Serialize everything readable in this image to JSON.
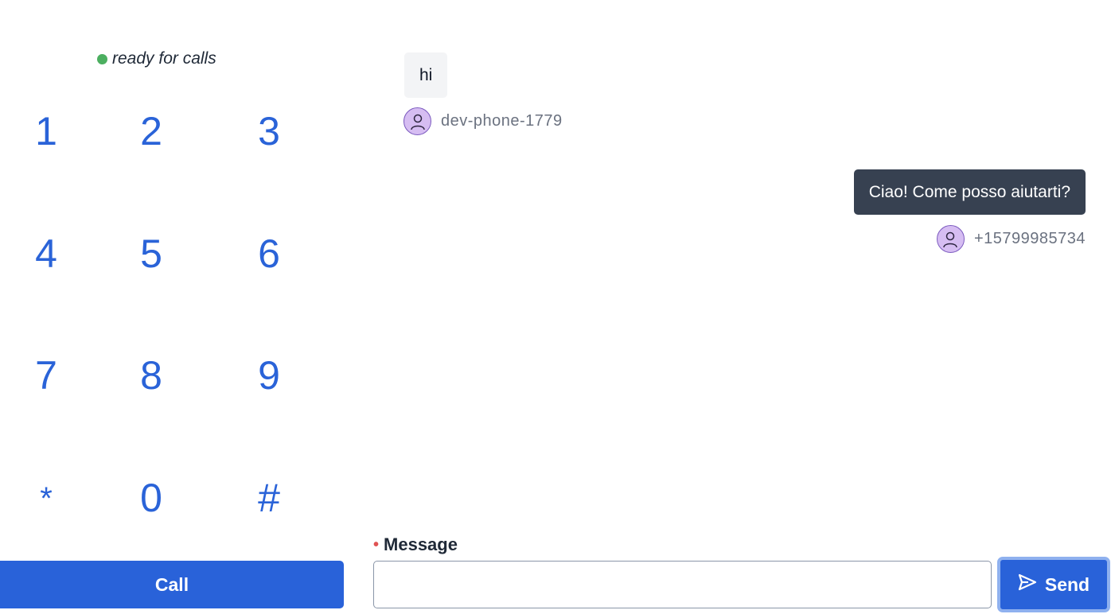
{
  "dialer": {
    "status_text": "ready for calls",
    "status_color": "#4caf60",
    "keys": [
      "1",
      "2",
      "3",
      "4",
      "5",
      "6",
      "7",
      "8",
      "9",
      "*",
      "0",
      "#"
    ],
    "call_label": "Call"
  },
  "chat": {
    "messages": [
      {
        "text": "hi",
        "author": "dev-phone-1779",
        "direction": "incoming"
      },
      {
        "text": "Ciao! Come posso aiutarti?",
        "author": "+15799985734",
        "direction": "outgoing"
      }
    ]
  },
  "composer": {
    "label": "Message",
    "value": "",
    "send_label": "Send"
  },
  "colors": {
    "accent": "#2962d9",
    "outgoing_bubble": "#374151",
    "incoming_bubble": "#f3f4f6",
    "avatar_bg": "#d6bdf2"
  },
  "icons": {
    "avatar": "user-icon",
    "send": "send-icon"
  }
}
